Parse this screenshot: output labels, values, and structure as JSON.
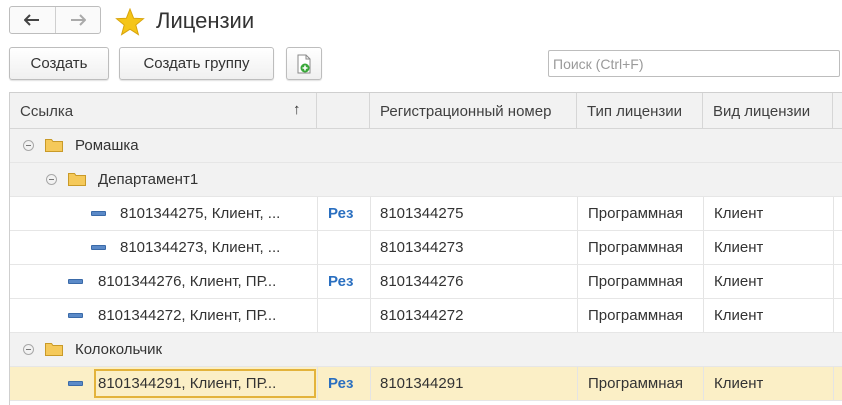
{
  "header": {
    "title": "Лицензии",
    "back_icon": "arrow-left-icon",
    "forward_icon": "arrow-right-icon",
    "favorite_icon": "star-icon",
    "favorite_color": "#f5c518"
  },
  "toolbar": {
    "create_label": "Создать",
    "create_group_label": "Создать группу",
    "add_document_icon": "document-add-icon",
    "search_placeholder": "Поиск (Ctrl+F)"
  },
  "table": {
    "columns": [
      "Ссылка",
      "",
      "Регистрационный номер",
      "Тип лицензии",
      "Вид лицензии"
    ],
    "sort_indicator": "↑",
    "rows": [
      {
        "kind": "group",
        "name": "Ромашка"
      },
      {
        "kind": "group",
        "name": "Департамент1"
      },
      {
        "kind": "item",
        "link": "8101344275, Клиент, ...",
        "flag": "Рез",
        "reg": "8101344275",
        "type": "Программная",
        "view": "Клиент"
      },
      {
        "kind": "item",
        "link": "8101344273, Клиент, ...",
        "flag": "",
        "reg": "8101344273",
        "type": "Программная",
        "view": "Клиент"
      },
      {
        "kind": "item",
        "link": "8101344276, Клиент, ПР...",
        "flag": "Рез",
        "reg": "8101344276",
        "type": "Программная",
        "view": "Клиент"
      },
      {
        "kind": "item",
        "link": "8101344272, Клиент, ПР...",
        "flag": "",
        "reg": "8101344272",
        "type": "Программная",
        "view": "Клиент"
      },
      {
        "kind": "group",
        "name": "Колокольчик"
      },
      {
        "kind": "item",
        "link": "8101344291, Клиент, ПР...",
        "flag": "Рез",
        "reg": "8101344291",
        "type": "Программная",
        "view": "Клиент",
        "selected": true
      }
    ]
  },
  "colors": {
    "reserve_text": "#2a6fc0",
    "selected_row": "#fbefc6",
    "selection_border": "#e3b33b",
    "folder": "#f5c95a"
  }
}
